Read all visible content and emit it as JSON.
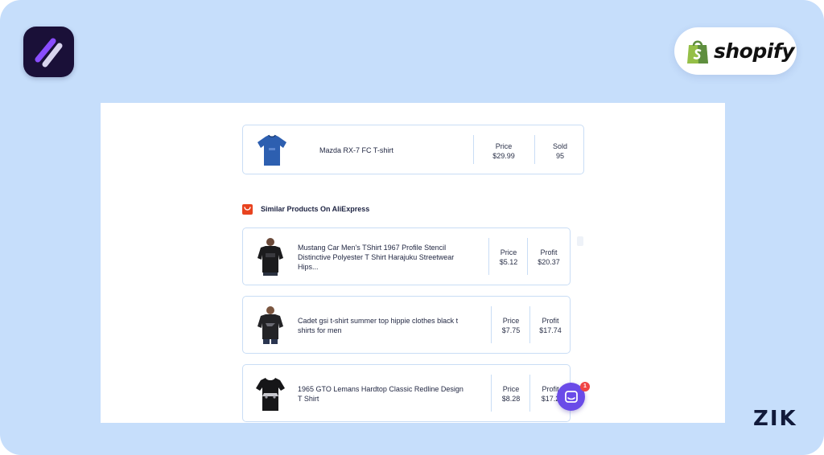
{
  "brand": {
    "shopify_wordmark": "shopify",
    "zik_wordmark": "ZIK"
  },
  "main_product": {
    "name": "Mazda RX-7 FC T-shirt",
    "price_label": "Price",
    "price_value": "$29.99",
    "sold_label": "Sold",
    "sold_value": "95",
    "icon": "blue-tshirt-icon"
  },
  "similar_section": {
    "title": "Similar Products On AliExpress",
    "icon": "aliexpress-icon"
  },
  "similar_products": [
    {
      "title": "Mustang Car Men's TShirt 1967 Profile Stencil Distinctive Polyester T Shirt Harajuku Streetwear Hips...",
      "price_label": "Price",
      "price_value": "$5.12",
      "profit_label": "Profit",
      "profit_value": "$20.37"
    },
    {
      "title": "Cadet gsi t-shirt summer top hippie clothes black t shirts for men",
      "price_label": "Price",
      "price_value": "$7.75",
      "profit_label": "Profit",
      "profit_value": "$17.74"
    },
    {
      "title": "1965 GTO Lemans Hardtop Classic Redline Design T Shirt",
      "price_label": "Price",
      "price_value": "$8.28",
      "profit_label": "Profit",
      "profit_value": "$17.2"
    }
  ],
  "chat": {
    "badge_count": "1",
    "icon": "chat-icon"
  },
  "colors": {
    "background": "#c6defb",
    "accent": "#6a4be8",
    "card_border": "#c9ddf5",
    "aliexpress": "#e8431f"
  }
}
